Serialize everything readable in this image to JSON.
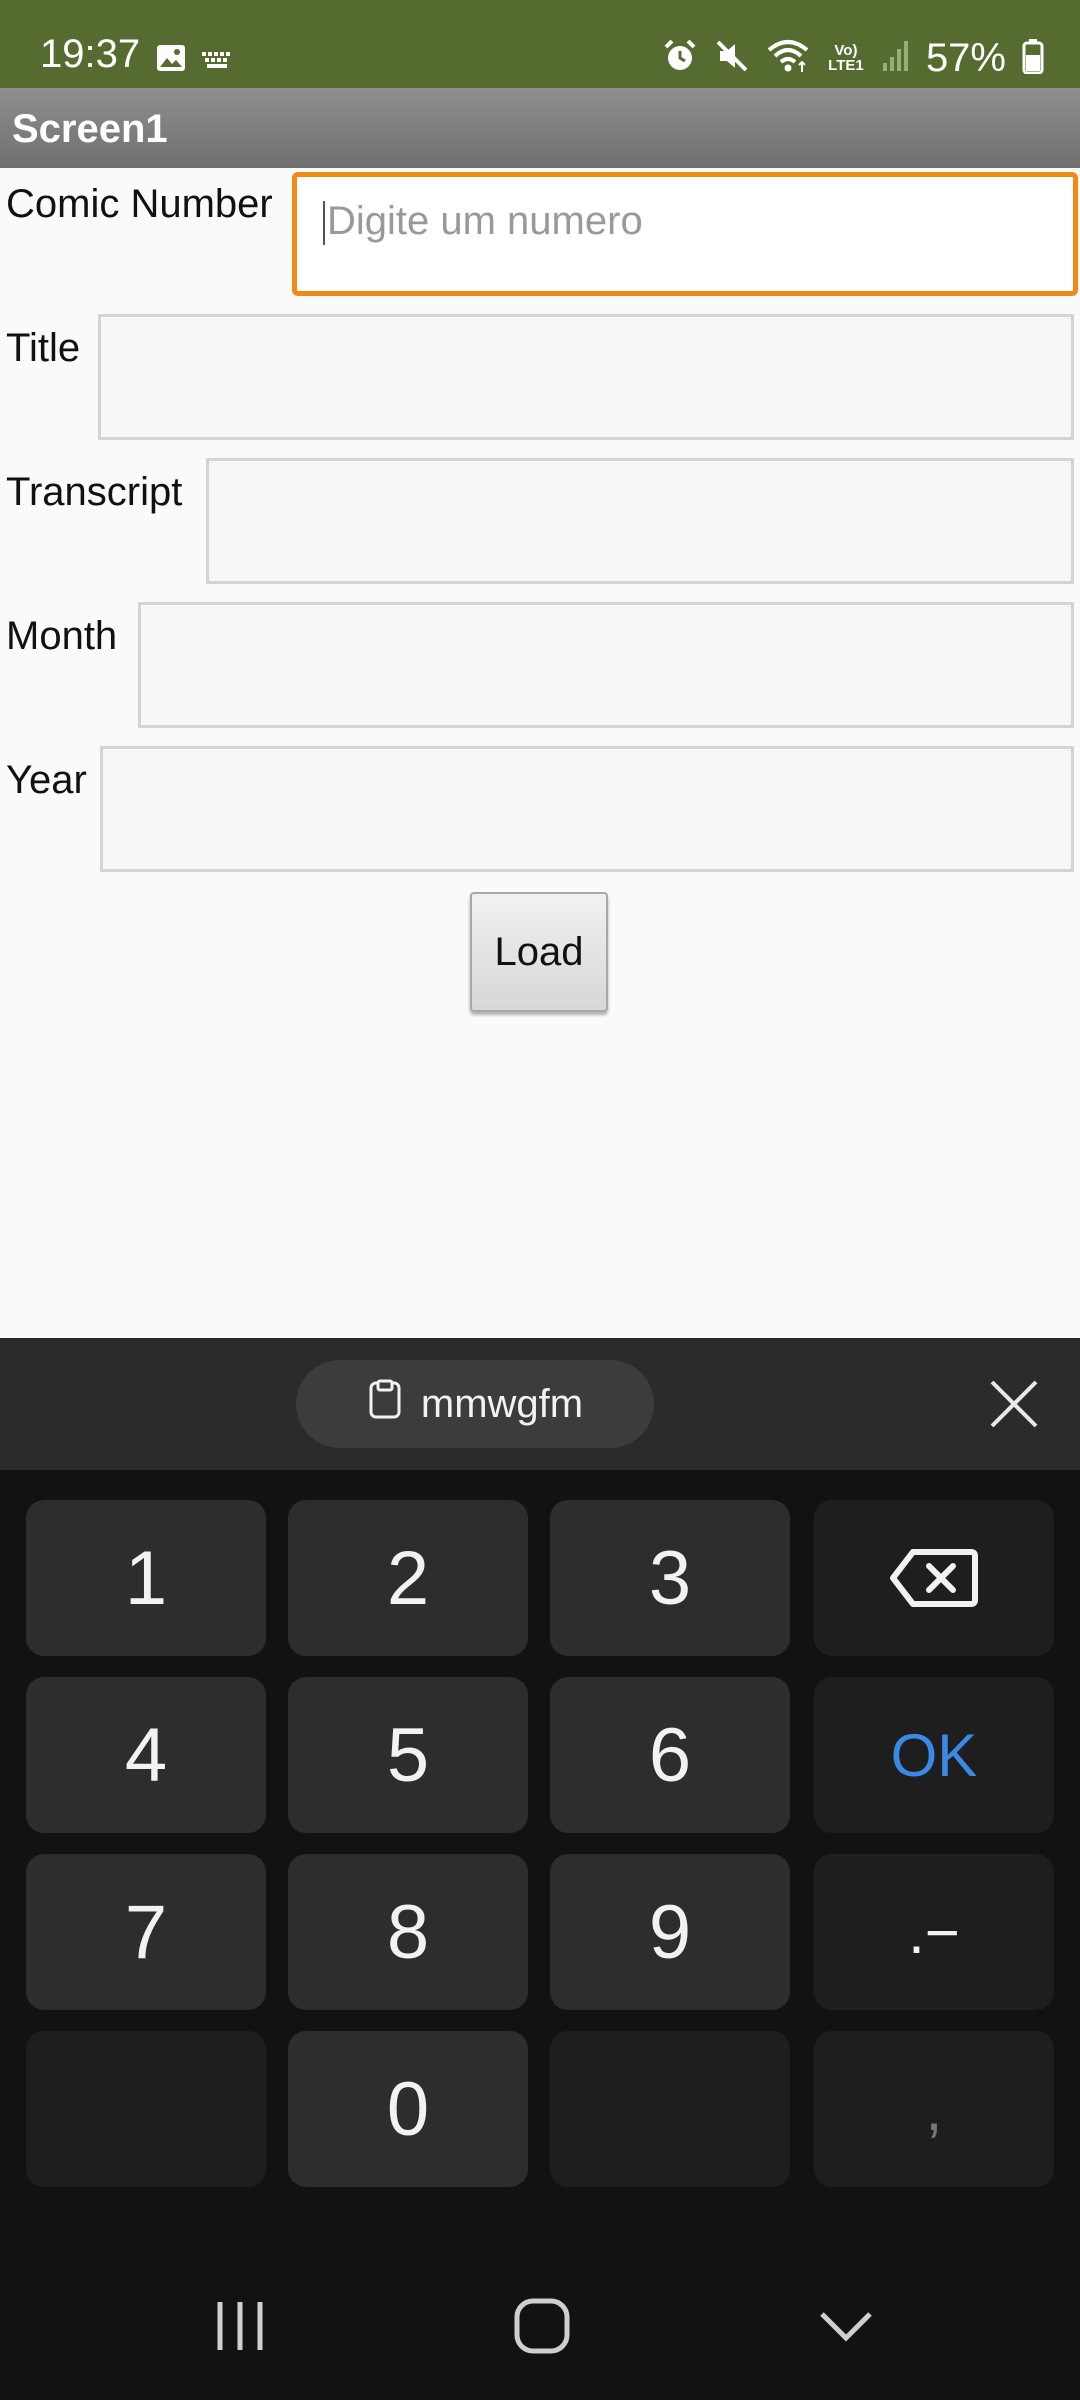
{
  "status_bar": {
    "time": "19:37",
    "battery": "57%",
    "signal_label": "Vo) LTE1",
    "icons": [
      "gallery-icon",
      "keyboard-icon",
      "alarm-icon",
      "mute-icon",
      "wifi-icon",
      "lte-icon",
      "signal-icon",
      "battery-icon"
    ]
  },
  "app": {
    "title": "Screen1"
  },
  "form": {
    "comic_number_label": "Comic Number",
    "comic_number_placeholder": "Digite um numero",
    "title_label": "Title",
    "transcript_label": "Transcript",
    "month_label": "Month",
    "year_label": "Year",
    "load_label": "Load"
  },
  "keyboard": {
    "clipboard_text": "mmwgfm",
    "keys": {
      "k1": "1",
      "k2": "2",
      "k3": "3",
      "k4": "4",
      "k5": "5",
      "k6": "6",
      "k7": "7",
      "k8": "8",
      "k9": "9",
      "k0": "0",
      "ok": "OK",
      "dot_dash": ".−",
      "comma": ","
    },
    "ok_color": "#3b89e6"
  },
  "colors": {
    "status_bar": "#556b2f",
    "focus_border": "#ef8a17"
  }
}
